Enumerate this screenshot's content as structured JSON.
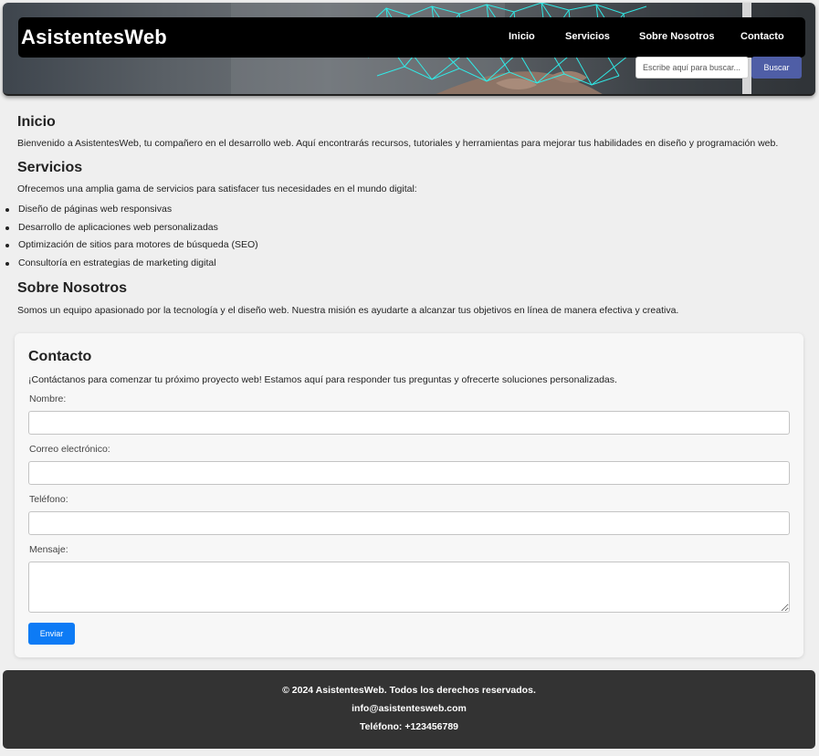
{
  "header": {
    "brand": "AsistentesWeb",
    "nav": [
      {
        "label": "Inicio"
      },
      {
        "label": "Servicios"
      },
      {
        "label": "Sobre Nosotros"
      },
      {
        "label": "Contacto"
      }
    ],
    "search": {
      "placeholder": "Escribe aquí para buscar...",
      "value": "",
      "button_label": "Buscar"
    },
    "banner_icons": [
      "hand-icon",
      "network-mesh-icon"
    ]
  },
  "sections": {
    "inicio": {
      "title": "Inicio",
      "text": "Bienvenido a AsistentesWeb, tu compañero en el desarrollo web. Aquí encontrarás recursos, tutoriales y herramientas para mejorar tus habilidades en diseño y programación web."
    },
    "servicios": {
      "title": "Servicios",
      "text": "Ofrecemos una amplia gama de servicios para satisfacer tus necesidades en el mundo digital:",
      "items": [
        "Diseño de páginas web responsivas",
        "Desarrollo de aplicaciones web personalizadas",
        "Optimización de sitios para motores de búsqueda (SEO)",
        "Consultoría en estrategias de marketing digital"
      ]
    },
    "sobre": {
      "title": "Sobre Nosotros",
      "text": "Somos un equipo apasionado por la tecnología y el diseño web. Nuestra misión es ayudarte a alcanzar tus objetivos en línea de manera efectiva y creativa."
    }
  },
  "contact": {
    "title": "Contacto",
    "intro": "¡Contáctanos para comenzar tu próximo proyecto web! Estamos aquí para responder tus preguntas y ofrecerte soluciones personalizadas.",
    "fields": {
      "nombre": {
        "label": "Nombre:",
        "value": ""
      },
      "correo": {
        "label": "Correo electrónico:",
        "value": ""
      },
      "telefono": {
        "label": "Teléfono:",
        "value": ""
      },
      "mensaje": {
        "label": "Mensaje:",
        "value": ""
      }
    },
    "submit_label": "Enviar"
  },
  "footer": {
    "copyright": "© 2024 AsistentesWeb. Todos los derechos reservados.",
    "email": "info@asistentesweb.com",
    "phone": "Teléfono: +123456789"
  },
  "colors": {
    "nav_bar": "#000000",
    "search_button": "#4f5ea6",
    "send_button": "#0d7bf5",
    "footer_bg": "#333333",
    "mesh_accent": "#2ef2ee"
  }
}
